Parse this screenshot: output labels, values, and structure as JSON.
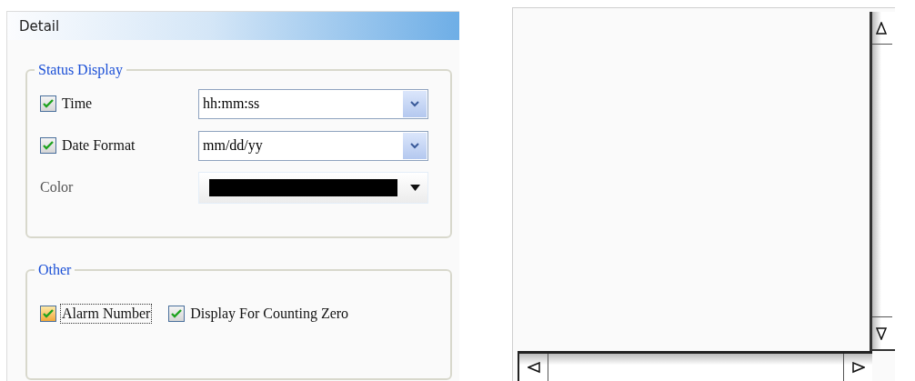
{
  "detail_panel": {
    "title": "Detail",
    "groups": [
      {
        "title": "Status Display",
        "rows": [
          {
            "kind": "select",
            "label": "Time",
            "checked": true,
            "value": "hh:mm:ss"
          },
          {
            "kind": "select",
            "label": "Date Format",
            "checked": true,
            "value": "mm/dd/yy"
          },
          {
            "kind": "color",
            "label": "Color",
            "color": "#000000"
          }
        ]
      },
      {
        "title": "Other",
        "checkboxes": [
          {
            "label": "Alarm Number",
            "checked": true,
            "focused": true
          },
          {
            "label": "Display For Counting Zero",
            "checked": true,
            "focused": false
          }
        ]
      }
    ]
  },
  "preview_panel": {
    "kind": "scroll-area"
  }
}
